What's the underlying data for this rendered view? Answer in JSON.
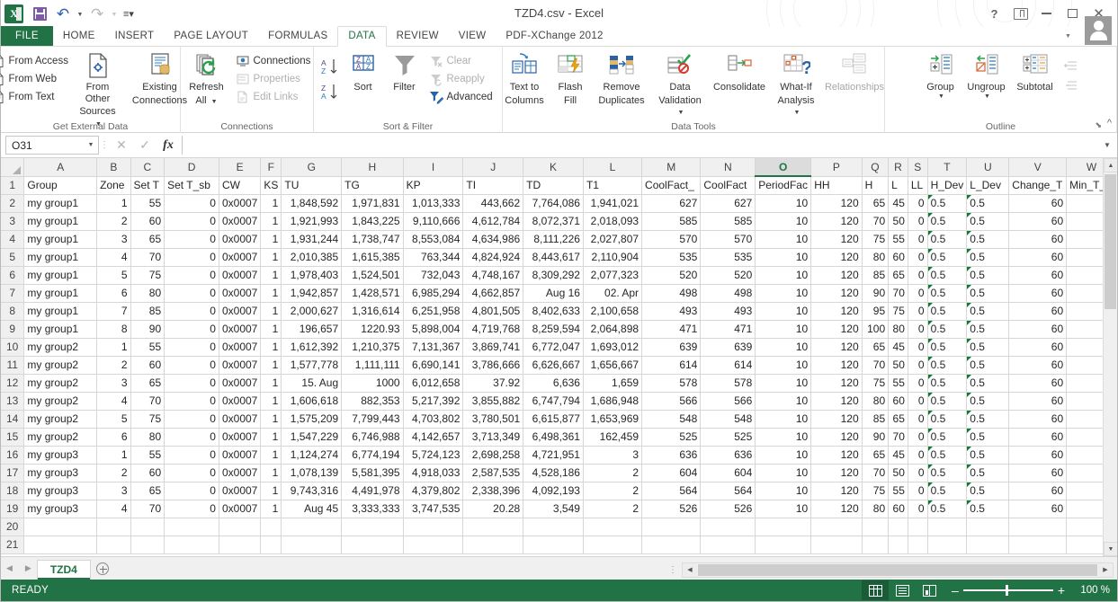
{
  "window": {
    "title": "TZD4.csv - Excel",
    "help_icon": "?",
    "ribbon_display_icon": "ribbon-display-options",
    "minimize_icon": "–",
    "maximize_icon": "□",
    "close_icon": "✕"
  },
  "qat": {
    "logo": "X",
    "save_label": "Save",
    "undo_label": "Undo",
    "redo_label": "Redo",
    "customize_label": "Customize Quick Access Toolbar"
  },
  "ribbon_tabs": [
    {
      "label": "FILE",
      "active": false
    },
    {
      "label": "HOME",
      "active": false
    },
    {
      "label": "INSERT",
      "active": false
    },
    {
      "label": "PAGE LAYOUT",
      "active": false
    },
    {
      "label": "FORMULAS",
      "active": false
    },
    {
      "label": "DATA",
      "active": true
    },
    {
      "label": "REVIEW",
      "active": false
    },
    {
      "label": "VIEW",
      "active": false
    },
    {
      "label": "PDF-XChange 2012",
      "active": false
    }
  ],
  "ribbon_groups": [
    {
      "title": "Get External Data",
      "small_items": [
        {
          "label": "From Access",
          "icon": "from-access-icon"
        },
        {
          "label": "From Web",
          "icon": "from-web-icon"
        },
        {
          "label": "From Text",
          "icon": "from-text-icon"
        }
      ],
      "big_items": [
        {
          "label": "From Other\nSources",
          "line1": "From Other",
          "line2": "Sources",
          "icon": "from-other-sources-icon",
          "dropdown": true
        },
        {
          "label": "Existing\nConnections",
          "line1": "Existing",
          "line2": "Connections",
          "icon": "existing-connections-icon",
          "dropdown": false
        }
      ]
    },
    {
      "title": "Connections",
      "big_items": [
        {
          "line1": "Refresh",
          "line2": "All",
          "icon": "refresh-all-icon",
          "dropdown": true
        }
      ],
      "small_items": [
        {
          "label": "Connections",
          "icon": "connections-icon",
          "disabled": false
        },
        {
          "label": "Properties",
          "icon": "properties-icon",
          "disabled": true
        },
        {
          "label": "Edit Links",
          "icon": "edit-links-icon",
          "disabled": true
        }
      ]
    },
    {
      "title": "Sort & Filter",
      "sort_az_label": "Sort A to Z",
      "sort_za_label": "Sort Z to A",
      "big_items": [
        {
          "line1": "Sort",
          "line2": "",
          "icon": "sort-dialog-icon"
        },
        {
          "line1": "Filter",
          "line2": "",
          "icon": "filter-icon"
        }
      ],
      "small_items": [
        {
          "label": "Clear",
          "icon": "clear-filter-icon",
          "disabled": true
        },
        {
          "label": "Reapply",
          "icon": "reapply-filter-icon",
          "disabled": true
        },
        {
          "label": "Advanced",
          "icon": "advanced-filter-icon",
          "disabled": false
        }
      ]
    },
    {
      "title": "Data Tools",
      "big_items": [
        {
          "line1": "Text to",
          "line2": "Columns",
          "icon": "text-to-columns-icon"
        },
        {
          "line1": "Flash",
          "line2": "Fill",
          "icon": "flash-fill-icon"
        },
        {
          "line1": "Remove",
          "line2": "Duplicates",
          "icon": "remove-duplicates-icon"
        },
        {
          "line1": "Data",
          "line2": "Validation",
          "icon": "data-validation-icon",
          "dropdown": true
        },
        {
          "line1": "Consolidate",
          "line2": "",
          "icon": "consolidate-icon"
        },
        {
          "line1": "What-If",
          "line2": "Analysis",
          "icon": "what-if-analysis-icon",
          "dropdown": true
        },
        {
          "line1": "Relationships",
          "line2": "",
          "icon": "relationships-icon",
          "disabled": true
        }
      ]
    },
    {
      "title": "Outline",
      "big_items": [
        {
          "line1": "Group",
          "line2": "",
          "icon": "group-icon",
          "dropdown": true
        },
        {
          "line1": "Ungroup",
          "line2": "",
          "icon": "ungroup-icon",
          "dropdown": true
        },
        {
          "line1": "Subtotal",
          "line2": "",
          "icon": "subtotal-icon"
        }
      ],
      "small_items": [
        {
          "label": "Show Detail",
          "icon": "show-detail-icon",
          "disabled": true
        },
        {
          "label": "Hide Detail",
          "icon": "hide-detail-icon",
          "disabled": true
        }
      ],
      "dialog_launcher": "⬊"
    }
  ],
  "formula_bar": {
    "name_box_value": "O31",
    "cancel_icon": "✕",
    "enter_icon": "✓",
    "function_icon": "fx",
    "formula_value": "",
    "expand_icon": "⌄"
  },
  "grid": {
    "columns": [
      "A",
      "B",
      "C",
      "D",
      "E",
      "F",
      "G",
      "H",
      "I",
      "J",
      "K",
      "L",
      "M",
      "N",
      "O",
      "P",
      "Q",
      "R",
      "S",
      "T",
      "U",
      "V",
      "W"
    ],
    "selected_column": "O",
    "headers": [
      "Group",
      "Zone",
      "Set T",
      "Set T_sb",
      "CW",
      "KS",
      "TU",
      "TG",
      "KP",
      "TI",
      "TD",
      "T1",
      "CoolFact_",
      "CoolFact",
      "PeriodFac",
      "HH",
      "H",
      "L",
      "LL",
      "H_Dev",
      "L_Dev",
      "Change_T",
      "Min_T_C"
    ],
    "row_numbers": [
      1,
      2,
      3,
      4,
      5,
      6,
      7,
      8,
      9,
      10,
      11,
      12,
      13,
      14,
      15,
      16,
      17,
      18,
      19,
      20,
      21
    ],
    "rows": [
      {
        "n": 2,
        "cells": [
          "my group1",
          "1",
          "55",
          "0",
          "0x0007",
          "1",
          "1,848,592",
          "1,971,831",
          "1,013,333",
          "443,662",
          "7,764,086",
          "1,941,021",
          "627",
          "627",
          "10",
          "120",
          "65",
          "45",
          "0",
          "0.5",
          "0.5",
          "60",
          ""
        ]
      },
      {
        "n": 3,
        "cells": [
          "my group1",
          "2",
          "60",
          "0",
          "0x0007",
          "1",
          "1,921,993",
          "1,843,225",
          "9,110,666",
          "4,612,784",
          "8,072,371",
          "2,018,093",
          "585",
          "585",
          "10",
          "120",
          "70",
          "50",
          "0",
          "0.5",
          "0.5",
          "60",
          ""
        ]
      },
      {
        "n": 4,
        "cells": [
          "my group1",
          "3",
          "65",
          "0",
          "0x0007",
          "1",
          "1,931,244",
          "1,738,747",
          "8,553,084",
          "4,634,986",
          "8,111,226",
          "2,027,807",
          "570",
          "570",
          "10",
          "120",
          "75",
          "55",
          "0",
          "0.5",
          "0.5",
          "60",
          ""
        ]
      },
      {
        "n": 5,
        "cells": [
          "my group1",
          "4",
          "70",
          "0",
          "0x0007",
          "1",
          "2,010,385",
          "1,615,385",
          "763,344",
          "4,824,924",
          "8,443,617",
          "2,110,904",
          "535",
          "535",
          "10",
          "120",
          "80",
          "60",
          "0",
          "0.5",
          "0.5",
          "60",
          ""
        ]
      },
      {
        "n": 6,
        "cells": [
          "my group1",
          "5",
          "75",
          "0",
          "0x0007",
          "1",
          "1,978,403",
          "1,524,501",
          "732,043",
          "4,748,167",
          "8,309,292",
          "2,077,323",
          "520",
          "520",
          "10",
          "120",
          "85",
          "65",
          "0",
          "0.5",
          "0.5",
          "60",
          ""
        ]
      },
      {
        "n": 7,
        "cells": [
          "my group1",
          "6",
          "80",
          "0",
          "0x0007",
          "1",
          "1,942,857",
          "1,428,571",
          "6,985,294",
          "4,662,857",
          "Aug 16",
          "02. Apr",
          "498",
          "498",
          "10",
          "120",
          "90",
          "70",
          "0",
          "0.5",
          "0.5",
          "60",
          ""
        ]
      },
      {
        "n": 8,
        "cells": [
          "my group1",
          "7",
          "85",
          "0",
          "0x0007",
          "1",
          "2,000,627",
          "1,316,614",
          "6,251,958",
          "4,801,505",
          "8,402,633",
          "2,100,658",
          "493",
          "493",
          "10",
          "120",
          "95",
          "75",
          "0",
          "0.5",
          "0.5",
          "60",
          ""
        ]
      },
      {
        "n": 9,
        "cells": [
          "my group1",
          "8",
          "90",
          "0",
          "0x0007",
          "1",
          "196,657",
          "1220.93",
          "5,898,004",
          "4,719,768",
          "8,259,594",
          "2,064,898",
          "471",
          "471",
          "10",
          "120",
          "100",
          "80",
          "0",
          "0.5",
          "0.5",
          "60",
          ""
        ]
      },
      {
        "n": 10,
        "cells": [
          "my group2",
          "1",
          "55",
          "0",
          "0x0007",
          "1",
          "1,612,392",
          "1,210,375",
          "7,131,367",
          "3,869,741",
          "6,772,047",
          "1,693,012",
          "639",
          "639",
          "10",
          "120",
          "65",
          "45",
          "0",
          "0.5",
          "0.5",
          "60",
          ""
        ]
      },
      {
        "n": 11,
        "cells": [
          "my group2",
          "2",
          "60",
          "0",
          "0x0007",
          "1",
          "1,577,778",
          "1,111,111",
          "6,690,141",
          "3,786,666",
          "6,626,667",
          "1,656,667",
          "614",
          "614",
          "10",
          "120",
          "70",
          "50",
          "0",
          "0.5",
          "0.5",
          "60",
          ""
        ]
      },
      {
        "n": 12,
        "cells": [
          "my group2",
          "3",
          "65",
          "0",
          "0x0007",
          "1",
          "15. Aug",
          "1000",
          "6,012,658",
          "37.92",
          "6,636",
          "1,659",
          "578",
          "578",
          "10",
          "120",
          "75",
          "55",
          "0",
          "0.5",
          "0.5",
          "60",
          ""
        ]
      },
      {
        "n": 13,
        "cells": [
          "my group2",
          "4",
          "70",
          "0",
          "0x0007",
          "1",
          "1,606,618",
          "882,353",
          "5,217,392",
          "3,855,882",
          "6,747,794",
          "1,686,948",
          "566",
          "566",
          "10",
          "120",
          "80",
          "60",
          "0",
          "0.5",
          "0.5",
          "60",
          ""
        ]
      },
      {
        "n": 14,
        "cells": [
          "my group2",
          "5",
          "75",
          "0",
          "0x0007",
          "1",
          "1,575,209",
          "7,799,443",
          "4,703,802",
          "3,780,501",
          "6,615,877",
          "1,653,969",
          "548",
          "548",
          "10",
          "120",
          "85",
          "65",
          "0",
          "0.5",
          "0.5",
          "60",
          ""
        ]
      },
      {
        "n": 15,
        "cells": [
          "my group2",
          "6",
          "80",
          "0",
          "0x0007",
          "1",
          "1,547,229",
          "6,746,988",
          "4,142,657",
          "3,713,349",
          "6,498,361",
          "162,459",
          "525",
          "525",
          "10",
          "120",
          "90",
          "70",
          "0",
          "0.5",
          "0.5",
          "60",
          ""
        ]
      },
      {
        "n": 16,
        "cells": [
          "my group3",
          "1",
          "55",
          "0",
          "0x0007",
          "1",
          "1,124,274",
          "6,774,194",
          "5,724,123",
          "2,698,258",
          "4,721,951",
          "3",
          "636",
          "636",
          "10",
          "120",
          "65",
          "45",
          "0",
          "0.5",
          "0.5",
          "60",
          ""
        ]
      },
      {
        "n": 17,
        "cells": [
          "my group3",
          "2",
          "60",
          "0",
          "0x0007",
          "1",
          "1,078,139",
          "5,581,395",
          "4,918,033",
          "2,587,535",
          "4,528,186",
          "2",
          "604",
          "604",
          "10",
          "120",
          "70",
          "50",
          "0",
          "0.5",
          "0.5",
          "60",
          ""
        ]
      },
      {
        "n": 18,
        "cells": [
          "my group3",
          "3",
          "65",
          "0",
          "0x0007",
          "1",
          "9,743,316",
          "4,491,978",
          "4,379,802",
          "2,338,396",
          "4,092,193",
          "2",
          "564",
          "564",
          "10",
          "120",
          "75",
          "55",
          "0",
          "0.5",
          "0.5",
          "60",
          ""
        ]
      },
      {
        "n": 19,
        "cells": [
          "my group3",
          "4",
          "70",
          "0",
          "0x0007",
          "1",
          "Aug 45",
          "3,333,333",
          "3,747,535",
          "20.28",
          "3,549",
          "2",
          "526",
          "526",
          "10",
          "120",
          "80",
          "60",
          "0",
          "0.5",
          "0.5",
          "60",
          ""
        ]
      },
      {
        "n": 20,
        "cells": [
          "",
          "",
          "",
          "",
          "",
          "",
          "",
          "",
          "",
          "",
          "",
          "",
          "",
          "",
          "",
          "",
          "",
          "",
          "",
          "",
          "",
          "",
          ""
        ]
      },
      {
        "n": 21,
        "cells": [
          "",
          "",
          "",
          "",
          "",
          "",
          "",
          "",
          "",
          "",
          "",
          "",
          "",
          "",
          "",
          "",
          "",
          "",
          "",
          "",
          "",
          "",
          ""
        ]
      }
    ]
  },
  "sheet_bar": {
    "prev_icon": "◀",
    "next_icon": "▶",
    "tabs": [
      {
        "name": "TZD4",
        "active": true
      }
    ],
    "add_sheet_label": "New sheet",
    "splitter_icon": "⋮"
  },
  "status_bar": {
    "mode": "READY",
    "view_normal": "Normal",
    "view_page_layout": "Page Layout",
    "view_page_break": "Page Break Preview",
    "zoom_out_icon": "–",
    "zoom_in_icon": "+",
    "zoom_value": "100 %"
  },
  "colors": {
    "excel_green": "#217346",
    "accent_blue": "#2a62a8",
    "error_triangle": "#0c7c2e"
  }
}
